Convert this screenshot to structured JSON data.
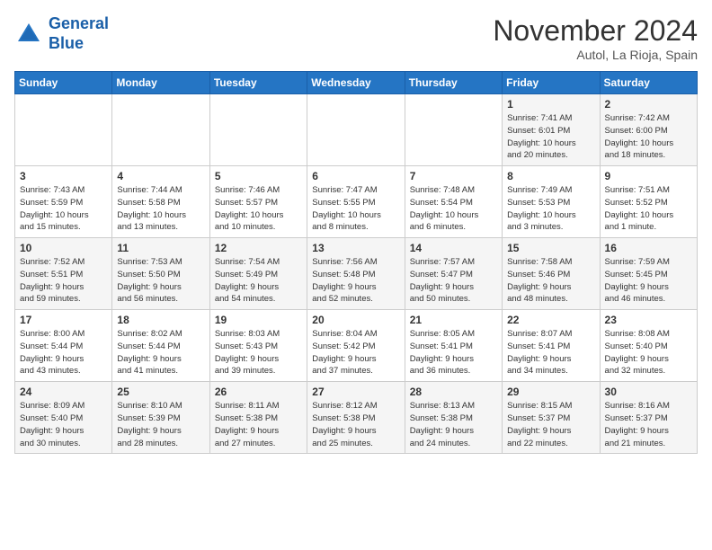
{
  "header": {
    "logo_line1": "General",
    "logo_line2": "Blue",
    "month": "November 2024",
    "location": "Autol, La Rioja, Spain"
  },
  "weekdays": [
    "Sunday",
    "Monday",
    "Tuesday",
    "Wednesday",
    "Thursday",
    "Friday",
    "Saturday"
  ],
  "weeks": [
    [
      {
        "day": "",
        "info": ""
      },
      {
        "day": "",
        "info": ""
      },
      {
        "day": "",
        "info": ""
      },
      {
        "day": "",
        "info": ""
      },
      {
        "day": "",
        "info": ""
      },
      {
        "day": "1",
        "info": "Sunrise: 7:41 AM\nSunset: 6:01 PM\nDaylight: 10 hours\nand 20 minutes."
      },
      {
        "day": "2",
        "info": "Sunrise: 7:42 AM\nSunset: 6:00 PM\nDaylight: 10 hours\nand 18 minutes."
      }
    ],
    [
      {
        "day": "3",
        "info": "Sunrise: 7:43 AM\nSunset: 5:59 PM\nDaylight: 10 hours\nand 15 minutes."
      },
      {
        "day": "4",
        "info": "Sunrise: 7:44 AM\nSunset: 5:58 PM\nDaylight: 10 hours\nand 13 minutes."
      },
      {
        "day": "5",
        "info": "Sunrise: 7:46 AM\nSunset: 5:57 PM\nDaylight: 10 hours\nand 10 minutes."
      },
      {
        "day": "6",
        "info": "Sunrise: 7:47 AM\nSunset: 5:55 PM\nDaylight: 10 hours\nand 8 minutes."
      },
      {
        "day": "7",
        "info": "Sunrise: 7:48 AM\nSunset: 5:54 PM\nDaylight: 10 hours\nand 6 minutes."
      },
      {
        "day": "8",
        "info": "Sunrise: 7:49 AM\nSunset: 5:53 PM\nDaylight: 10 hours\nand 3 minutes."
      },
      {
        "day": "9",
        "info": "Sunrise: 7:51 AM\nSunset: 5:52 PM\nDaylight: 10 hours\nand 1 minute."
      }
    ],
    [
      {
        "day": "10",
        "info": "Sunrise: 7:52 AM\nSunset: 5:51 PM\nDaylight: 9 hours\nand 59 minutes."
      },
      {
        "day": "11",
        "info": "Sunrise: 7:53 AM\nSunset: 5:50 PM\nDaylight: 9 hours\nand 56 minutes."
      },
      {
        "day": "12",
        "info": "Sunrise: 7:54 AM\nSunset: 5:49 PM\nDaylight: 9 hours\nand 54 minutes."
      },
      {
        "day": "13",
        "info": "Sunrise: 7:56 AM\nSunset: 5:48 PM\nDaylight: 9 hours\nand 52 minutes."
      },
      {
        "day": "14",
        "info": "Sunrise: 7:57 AM\nSunset: 5:47 PM\nDaylight: 9 hours\nand 50 minutes."
      },
      {
        "day": "15",
        "info": "Sunrise: 7:58 AM\nSunset: 5:46 PM\nDaylight: 9 hours\nand 48 minutes."
      },
      {
        "day": "16",
        "info": "Sunrise: 7:59 AM\nSunset: 5:45 PM\nDaylight: 9 hours\nand 46 minutes."
      }
    ],
    [
      {
        "day": "17",
        "info": "Sunrise: 8:00 AM\nSunset: 5:44 PM\nDaylight: 9 hours\nand 43 minutes."
      },
      {
        "day": "18",
        "info": "Sunrise: 8:02 AM\nSunset: 5:44 PM\nDaylight: 9 hours\nand 41 minutes."
      },
      {
        "day": "19",
        "info": "Sunrise: 8:03 AM\nSunset: 5:43 PM\nDaylight: 9 hours\nand 39 minutes."
      },
      {
        "day": "20",
        "info": "Sunrise: 8:04 AM\nSunset: 5:42 PM\nDaylight: 9 hours\nand 37 minutes."
      },
      {
        "day": "21",
        "info": "Sunrise: 8:05 AM\nSunset: 5:41 PM\nDaylight: 9 hours\nand 36 minutes."
      },
      {
        "day": "22",
        "info": "Sunrise: 8:07 AM\nSunset: 5:41 PM\nDaylight: 9 hours\nand 34 minutes."
      },
      {
        "day": "23",
        "info": "Sunrise: 8:08 AM\nSunset: 5:40 PM\nDaylight: 9 hours\nand 32 minutes."
      }
    ],
    [
      {
        "day": "24",
        "info": "Sunrise: 8:09 AM\nSunset: 5:40 PM\nDaylight: 9 hours\nand 30 minutes."
      },
      {
        "day": "25",
        "info": "Sunrise: 8:10 AM\nSunset: 5:39 PM\nDaylight: 9 hours\nand 28 minutes."
      },
      {
        "day": "26",
        "info": "Sunrise: 8:11 AM\nSunset: 5:38 PM\nDaylight: 9 hours\nand 27 minutes."
      },
      {
        "day": "27",
        "info": "Sunrise: 8:12 AM\nSunset: 5:38 PM\nDaylight: 9 hours\nand 25 minutes."
      },
      {
        "day": "28",
        "info": "Sunrise: 8:13 AM\nSunset: 5:38 PM\nDaylight: 9 hours\nand 24 minutes."
      },
      {
        "day": "29",
        "info": "Sunrise: 8:15 AM\nSunset: 5:37 PM\nDaylight: 9 hours\nand 22 minutes."
      },
      {
        "day": "30",
        "info": "Sunrise: 8:16 AM\nSunset: 5:37 PM\nDaylight: 9 hours\nand 21 minutes."
      }
    ]
  ]
}
